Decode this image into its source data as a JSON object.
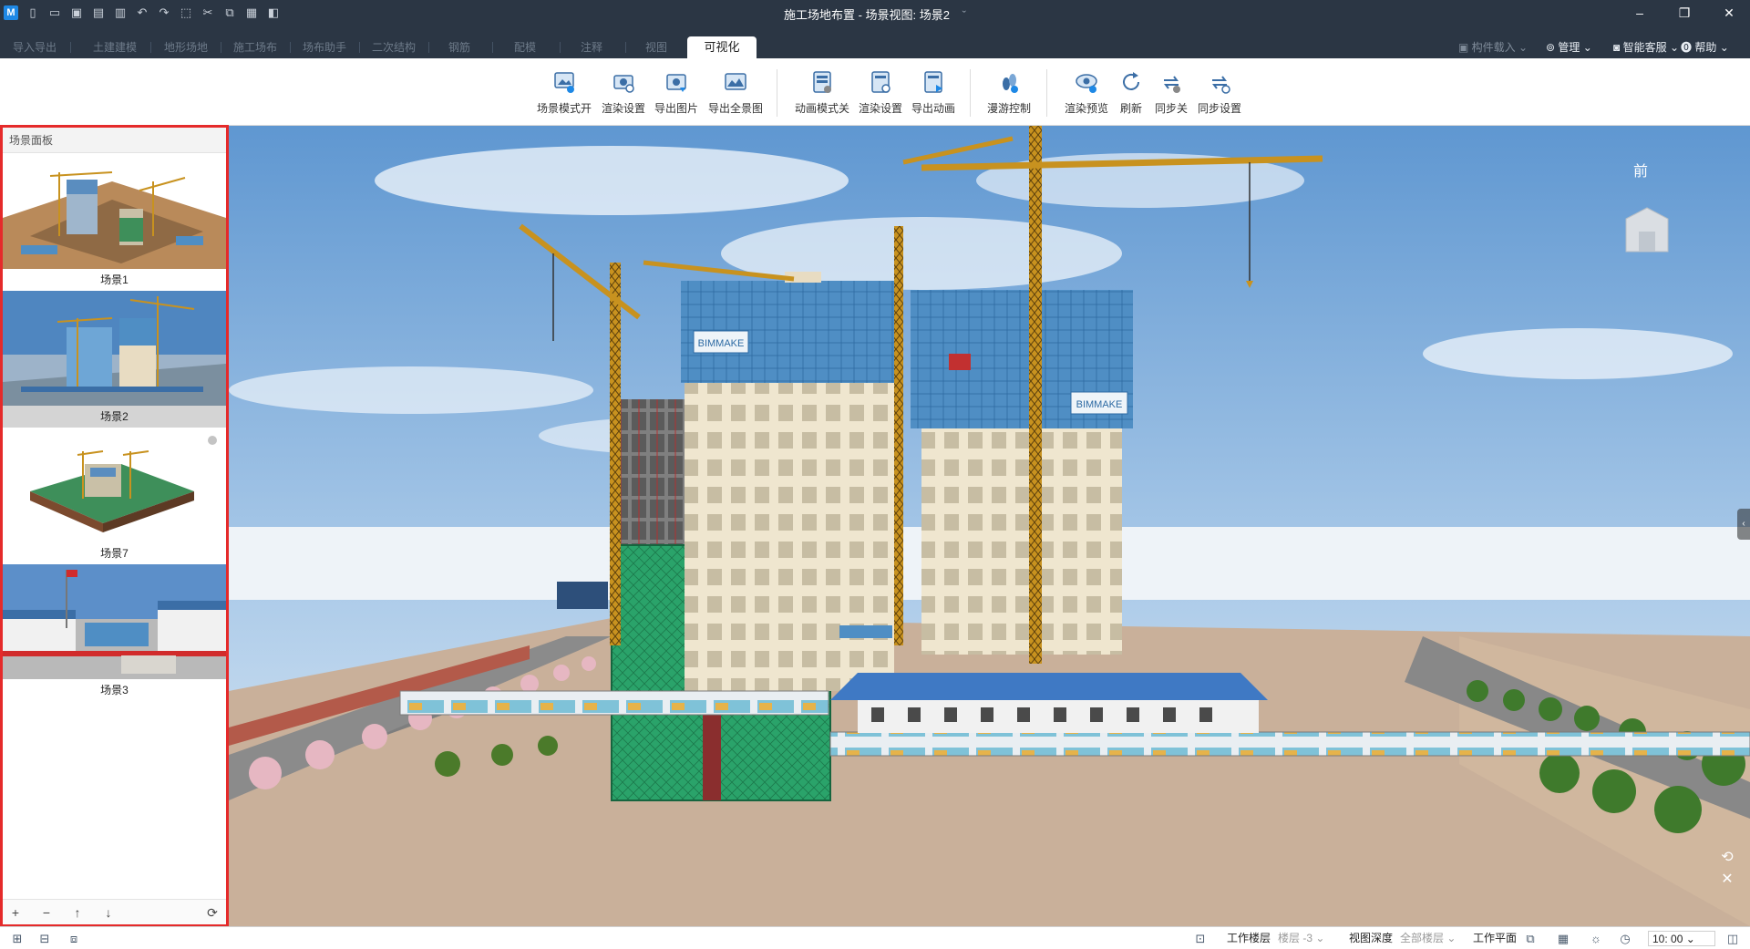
{
  "window": {
    "title": "施工场地布置 - 场景视图: 场景2",
    "title_extra": "ˇ"
  },
  "quick_access": [
    "new-file-icon",
    "open-folder-icon",
    "save-icon",
    "save-as-icon",
    "print-icon",
    "undo-icon",
    "redo-icon",
    "select-icon",
    "cut-icon",
    "copy-icon",
    "paste-icon",
    "cube-icon"
  ],
  "tabs": [
    {
      "label": "导入导出"
    },
    {
      "label": "土建建模"
    },
    {
      "label": "地形场地"
    },
    {
      "label": "施工场布"
    },
    {
      "label": "场布助手"
    },
    {
      "label": "二次结构"
    },
    {
      "label": "钢筋"
    },
    {
      "label": "配模"
    },
    {
      "label": "注释"
    },
    {
      "label": "视图"
    },
    {
      "label": "可视化"
    }
  ],
  "active_tab": "可视化",
  "right_menu": {
    "component_load": "构件载入",
    "manage": "管理",
    "support": "智能客服",
    "help": "帮助"
  },
  "toolbar": {
    "tools": [
      {
        "label": "场景模式开",
        "icon": "scene-mode-icon"
      },
      {
        "label": "渲染设置",
        "icon": "render-settings-icon"
      },
      {
        "label": "导出图片",
        "icon": "export-image-icon"
      },
      {
        "label": "导出全景图",
        "icon": "export-panorama-icon"
      },
      {
        "label": "动画模式关",
        "icon": "animation-mode-icon"
      },
      {
        "label": "渲染设置",
        "icon": "render-settings-icon"
      },
      {
        "label": "导出动画",
        "icon": "export-animation-icon"
      },
      {
        "label": "漫游控制",
        "icon": "roaming-control-icon"
      },
      {
        "label": "渲染预览",
        "icon": "render-preview-icon"
      },
      {
        "label": "刷新",
        "icon": "refresh-icon"
      },
      {
        "label": "同步关",
        "icon": "sync-off-icon"
      },
      {
        "label": "同步设置",
        "icon": "sync-settings-icon"
      }
    ]
  },
  "scene_panel": {
    "title": "场景面板",
    "scenes": [
      {
        "label": "场景1"
      },
      {
        "label": "场景2"
      },
      {
        "label": "场景7"
      },
      {
        "label": "场景3"
      }
    ],
    "selected": "场景2"
  },
  "viewport": {
    "view_label": "前",
    "brand_text": "BIMMAKE"
  },
  "statusbar": {
    "work_floor_label": "工作楼层",
    "work_floor_value": "楼层 -3",
    "view_depth_label": "视图深度",
    "view_depth_value": "全部楼层",
    "work_plane_label": "工作平面",
    "time_value": "10: 00"
  },
  "colors": {
    "titlebar": "#2b3644",
    "panel_border": "#e52a2a",
    "tower_crane": "#c8921f",
    "glass": "#4f8ec4",
    "safety_net": "#2aa36a"
  }
}
